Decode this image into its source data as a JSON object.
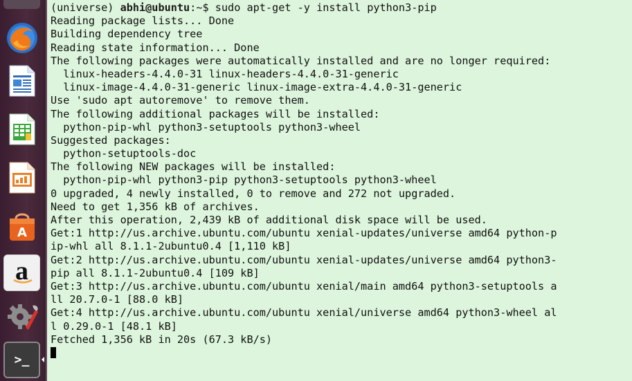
{
  "launcher": {
    "icons": [
      "firefox-icon",
      "writer-icon",
      "calc-icon",
      "impress-icon",
      "software-center-icon",
      "amazon-icon",
      "system-settings-icon",
      "terminal-icon"
    ],
    "amazon_glyph": "a",
    "terminal_glyph": ">_"
  },
  "terminal": {
    "prompt_env": "(universe) ",
    "prompt_user": "abhi@ubuntu",
    "prompt_path": ":~$ ",
    "command": "sudo apt-get -y install python3-pip",
    "output": [
      "Reading package lists... Done",
      "Building dependency tree",
      "Reading state information... Done",
      "The following packages were automatically installed and are no longer required:",
      "  linux-headers-4.4.0-31 linux-headers-4.4.0-31-generic",
      "  linux-image-4.4.0-31-generic linux-image-extra-4.4.0-31-generic",
      "Use 'sudo apt autoremove' to remove them.",
      "The following additional packages will be installed:",
      "  python-pip-whl python3-setuptools python3-wheel",
      "Suggested packages:",
      "  python-setuptools-doc",
      "The following NEW packages will be installed:",
      "  python-pip-whl python3-pip python3-setuptools python3-wheel",
      "0 upgraded, 4 newly installed, 0 to remove and 272 not upgraded.",
      "Need to get 1,356 kB of archives.",
      "After this operation, 2,439 kB of additional disk space will be used.",
      "Get:1 http://us.archive.ubuntu.com/ubuntu xenial-updates/universe amd64 python-p",
      "ip-whl all 8.1.1-2ubuntu0.4 [1,110 kB]",
      "Get:2 http://us.archive.ubuntu.com/ubuntu xenial-updates/universe amd64 python3-",
      "pip all 8.1.1-2ubuntu0.4 [109 kB]",
      "Get:3 http://us.archive.ubuntu.com/ubuntu xenial/main amd64 python3-setuptools a",
      "ll 20.7.0-1 [88.0 kB]",
      "Get:4 http://us.archive.ubuntu.com/ubuntu xenial/universe amd64 python3-wheel al",
      "l 0.29.0-1 [48.1 kB]",
      "Fetched 1,356 kB in 20s (67.3 kB/s)"
    ]
  },
  "colors": {
    "terminal_bg": "#dcf5dc",
    "launcher_bg": "#3a1d30"
  }
}
